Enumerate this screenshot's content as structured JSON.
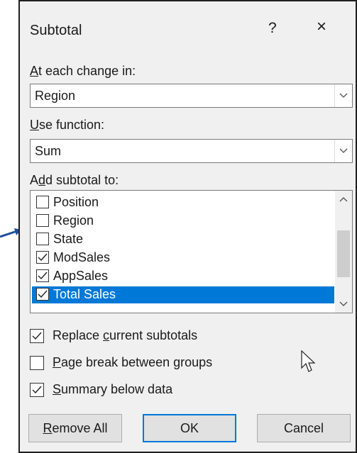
{
  "dialog": {
    "title": "Subtotal",
    "help": "?",
    "close": "×"
  },
  "at_each_change": {
    "label_u": "A",
    "label_rest": "t each change in:",
    "value": "Region"
  },
  "use_function": {
    "label_u": "U",
    "label_rest": "se function:",
    "value": "Sum"
  },
  "add_subtotal": {
    "label_pre": "A",
    "label_u": "d",
    "label_rest": "d subtotal to:",
    "items": [
      {
        "label": "Position",
        "checked": false,
        "selected": false
      },
      {
        "label": "Region",
        "checked": false,
        "selected": false
      },
      {
        "label": "State",
        "checked": false,
        "selected": false
      },
      {
        "label": "ModSales",
        "checked": true,
        "selected": false
      },
      {
        "label": "AppSales",
        "checked": true,
        "selected": false
      },
      {
        "label": "Total Sales",
        "checked": true,
        "selected": true
      }
    ]
  },
  "options": {
    "replace": {
      "pre": "Replace ",
      "u": "c",
      "rest": "urrent subtotals",
      "checked": true
    },
    "page_break": {
      "pre": "",
      "u": "P",
      "rest": "age break between groups",
      "checked": false
    },
    "summary": {
      "pre": "",
      "u": "S",
      "rest": "ummary below data",
      "checked": true
    }
  },
  "buttons": {
    "remove_u": "R",
    "remove_rest": "emove All",
    "ok": "OK",
    "cancel": "Cancel"
  }
}
